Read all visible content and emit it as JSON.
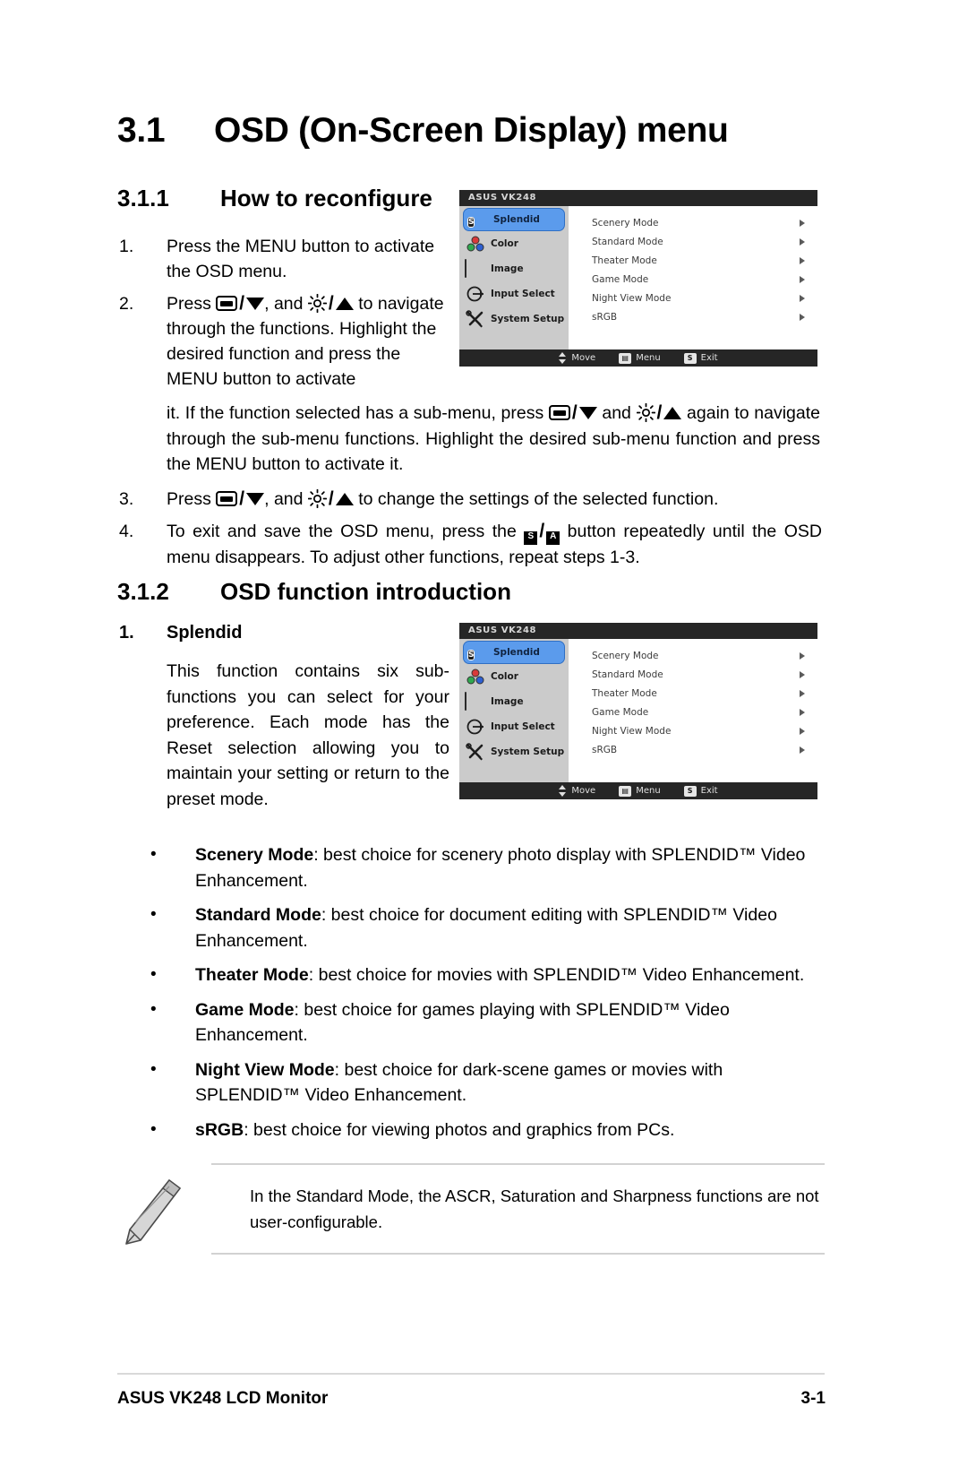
{
  "document": {
    "section_number": "3.1",
    "section_title": "OSD (On-Screen Display) menu",
    "subsection_1": {
      "number": "3.1.1",
      "title": "How to reconfigure"
    },
    "subsection_2": {
      "number": "3.1.2",
      "title": "OSD function introduction"
    }
  },
  "steps": [
    {
      "marker": "1.",
      "text": "Press the MENU button to activate the OSD menu."
    },
    {
      "marker": "2.",
      "lead": "Press",
      "mid": ", and",
      "tail": "to navigate through the functions. Highlight the desired function and press the MENU button to activate",
      "continuation_lead": "it. If the function selected has a sub-menu, press",
      "continuation_mid": "and",
      "continuation_tail": "again to navigate through the sub-menu functions. Highlight the desired sub-menu function and press the MENU button to activate it."
    },
    {
      "marker": "3.",
      "lead": "Press",
      "mid": ", and",
      "tail": "to change the settings of the selected function."
    },
    {
      "marker": "4.",
      "lead": "To exit and save the OSD menu, press the",
      "tail": "button repeatedly until the OSD menu disappears. To adjust other functions, repeat steps 1-3."
    }
  ],
  "splendid_item": {
    "marker": "1.",
    "title": "Splendid",
    "paragraph": "This function contains six sub-functions you can select for your preference. Each mode has the Reset selection allowing you to maintain your setting or return to the preset mode."
  },
  "bullets": [
    {
      "bold": "Scenery Mode",
      "rest": ": best choice for scenery photo display with SPLENDID™ Video Enhancement."
    },
    {
      "bold": "Standard Mode",
      "rest": ": best choice for document editing with SPLENDID™ Video Enhancement."
    },
    {
      "bold": "Theater Mode",
      "rest": ": best choice for movies with SPLENDID™ Video Enhancement."
    },
    {
      "bold": "Game Mode",
      "rest": ": best choice for games playing with SPLENDID™ Video Enhancement."
    },
    {
      "bold": "Night View Mode",
      "rest": ": best choice for dark-scene games or movies with SPLENDID™ Video Enhancement."
    },
    {
      "bold": "sRGB",
      "rest": ": best choice for viewing photos and graphics from PCs."
    }
  ],
  "note": {
    "text": "In the Standard Mode, the ASCR, Saturation and Sharpness functions are not user-configurable."
  },
  "footer": {
    "left": "ASUS VK248 LCD Monitor",
    "right": "3-1"
  },
  "osd": {
    "title": "ASUS VK248",
    "menu_items": [
      {
        "label": "Splendid",
        "icon": "splendid-icon",
        "selected": true
      },
      {
        "label": "Color",
        "icon": "color-icon",
        "selected": false
      },
      {
        "label": "Image",
        "icon": "image-icon",
        "selected": false
      },
      {
        "label": "Input Select",
        "icon": "input-select-icon",
        "selected": false
      },
      {
        "label": "System Setup",
        "icon": "system-setup-icon",
        "selected": false
      }
    ],
    "submenu_items": [
      "Scenery Mode",
      "Standard Mode",
      "Theater Mode",
      "Game Mode",
      "Night View Mode",
      "sRGB"
    ],
    "status_bar": {
      "move": "Move",
      "menu": "Menu",
      "exit": "Exit",
      "menu_key": "▤",
      "exit_key": "S"
    },
    "colors": {
      "title_bar": "#262626",
      "sidebar": "#cbcbcb",
      "highlight": "#5b9bec",
      "panel": "#ffffff"
    }
  }
}
